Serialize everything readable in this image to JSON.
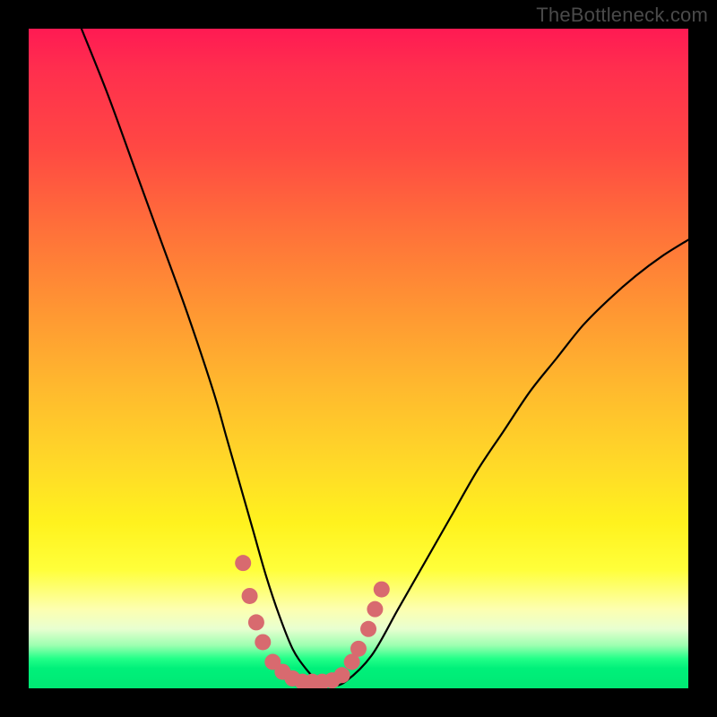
{
  "watermark": "TheBottleneck.com",
  "chart_data": {
    "type": "line",
    "title": "",
    "xlabel": "",
    "ylabel": "",
    "xlim": [
      0,
      100
    ],
    "ylim": [
      0,
      100
    ],
    "series": [
      {
        "name": "curve",
        "x": [
          8,
          12,
          16,
          20,
          24,
          28,
          30,
          32,
          34,
          36,
          38,
          40,
          42,
          44,
          46,
          48,
          52,
          56,
          60,
          64,
          68,
          72,
          76,
          80,
          84,
          88,
          92,
          96,
          100
        ],
        "values": [
          100,
          90,
          79,
          68,
          57,
          45,
          38,
          31,
          24,
          17,
          11,
          6,
          3,
          1,
          0.5,
          1,
          5,
          12,
          19,
          26,
          33,
          39,
          45,
          50,
          55,
          59,
          62.5,
          65.5,
          68
        ]
      }
    ],
    "markers": {
      "name": "bottom-cluster",
      "color": "#d86a6f",
      "points": [
        {
          "x": 32.5,
          "y": 19
        },
        {
          "x": 33.5,
          "y": 14
        },
        {
          "x": 34.5,
          "y": 10
        },
        {
          "x": 35.5,
          "y": 7
        },
        {
          "x": 37,
          "y": 4
        },
        {
          "x": 38.5,
          "y": 2.5
        },
        {
          "x": 40,
          "y": 1.5
        },
        {
          "x": 41.5,
          "y": 1
        },
        {
          "x": 43,
          "y": 1
        },
        {
          "x": 44.5,
          "y": 1
        },
        {
          "x": 46,
          "y": 1.2
        },
        {
          "x": 47.5,
          "y": 2
        },
        {
          "x": 49,
          "y": 4
        },
        {
          "x": 50,
          "y": 6
        },
        {
          "x": 51.5,
          "y": 9
        },
        {
          "x": 52.5,
          "y": 12
        },
        {
          "x": 53.5,
          "y": 15
        }
      ]
    },
    "gradient_stops": [
      {
        "pos": 0,
        "color": "#ff1a53"
      },
      {
        "pos": 0.3,
        "color": "#ff6f3a"
      },
      {
        "pos": 0.66,
        "color": "#ffd928"
      },
      {
        "pos": 0.88,
        "color": "#fdffb0"
      },
      {
        "pos": 0.955,
        "color": "#22ff88"
      },
      {
        "pos": 1.0,
        "color": "#00e874"
      }
    ]
  }
}
